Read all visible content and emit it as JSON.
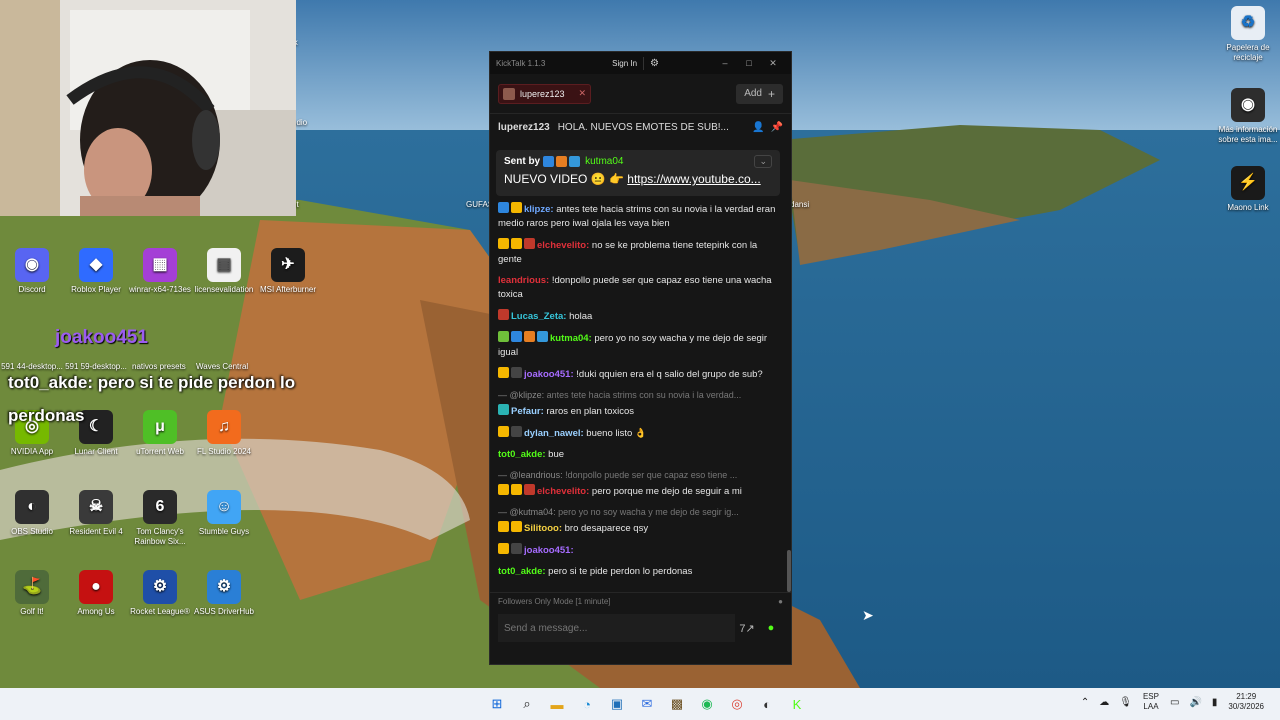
{
  "desktop": {
    "icons_left": [
      {
        "label": "Discord",
        "color": "#5865f2",
        "glyph": "◉"
      },
      {
        "label": "Roblox Player",
        "color": "#2f6bff",
        "glyph": "◆"
      },
      {
        "label": "winrar-x64-713es",
        "color": "#a43fd6",
        "glyph": "▦"
      },
      {
        "label": "licensevalidation",
        "color": "#f1f1f1",
        "glyph": "▤"
      },
      {
        "label": "MSI Afterburner",
        "color": "#1c1c1c",
        "glyph": "✈"
      },
      {
        "label": "NVIDIA App",
        "color": "#76b900",
        "glyph": "◎"
      },
      {
        "label": "Lunar Client",
        "color": "#222222",
        "glyph": "☾"
      },
      {
        "label": "uTorrent Web",
        "color": "#4fbf26",
        "glyph": "μ"
      },
      {
        "label": "FL Studio 2024",
        "color": "#f26b1d",
        "glyph": "♫"
      },
      {
        "label": "OBS Studio",
        "color": "#303030",
        "glyph": "◐"
      },
      {
        "label": "Resident Evil 4",
        "color": "#3a3a3a",
        "glyph": "☠"
      },
      {
        "label": "Tom Clancy's Rainbow Six...",
        "color": "#2a2a2a",
        "glyph": "6"
      },
      {
        "label": "Stumble Guys",
        "color": "#41a5f5",
        "glyph": "☺"
      },
      {
        "label": "Golf It!",
        "color": "#4f6b3a",
        "glyph": "⛳"
      },
      {
        "label": "Among Us",
        "color": "#c51111",
        "glyph": "●"
      },
      {
        "label": "Rocket League®",
        "color": "#1f4fa8",
        "glyph": "⚙"
      },
      {
        "label": "ASUS DriverHub",
        "color": "#2a7fd6",
        "glyph": "⚙"
      }
    ],
    "partial_labels": [
      "lk",
      "udio",
      "ut",
      "GUFAS",
      "dansi",
      "Waves Central",
      "nativos presets"
    ],
    "partial_desktop_labels": [
      "591 44-desktop...",
      "591 59-desktop..."
    ],
    "icons_right": [
      {
        "label": "Papelera de reciclaje",
        "color": "#e8eef5",
        "glyph": "♻"
      },
      {
        "label": "Más información sobre esta ima...",
        "color": "#2d2d2d",
        "glyph": "◉"
      },
      {
        "label": "Maono Link",
        "color": "#1a1a1a",
        "glyph": "⚡"
      }
    ]
  },
  "overlay": {
    "name": "joakoo451",
    "user": "tot0_akde",
    "message": ": pero si te pide perdon lo perdonas"
  },
  "window": {
    "title": "KickTalk 1.1.3",
    "sign_in": "Sign In",
    "tab_channel": "luperez123",
    "add_label": "Add",
    "pinned_header_user": "luperez123",
    "pinned_header_msg": "HOLA. NUEVOS EMOTES DE SUB!...",
    "pinned": {
      "sent_by": "Sent by",
      "user": "kutma04",
      "text": "NUEVO VIDEO",
      "link": "https://www.youtube.co..."
    },
    "messages": [
      {
        "type": "msg",
        "user": "klipze:",
        "color": "#6fa8ff",
        "badges": [
          "#2e86de",
          "#f5b700"
        ],
        "text": " antes tete hacia strims con su novia i la verdad eran medio raros pero iwal ojala les vaya bien"
      },
      {
        "type": "msg",
        "user": "elchevelito:",
        "color": "#e0303a",
        "badges": [
          "#f5b700",
          "#f5b700",
          "#c0392b"
        ],
        "text": " no se ke problema tiene tetepink con la gente"
      },
      {
        "type": "msg",
        "user": "leandrious:",
        "color": "#e0303a",
        "badges": [],
        "text": " !donpollo puede ser que capaz eso tiene una wacha toxica"
      },
      {
        "type": "msg",
        "user": "Lucas_Zeta:",
        "color": "#36c5d9",
        "badges": [
          "#c0392b"
        ],
        "text": " holaa"
      },
      {
        "type": "msg",
        "user": "kutma04:",
        "color": "#53fc18",
        "badges": [
          "#6fbf3a",
          "#2e86de",
          "#e67e22",
          "#3498db"
        ],
        "text": " pero yo no soy wacha y me dejo de segir igual"
      },
      {
        "type": "msg",
        "user": "joakoo451:",
        "color": "#a66cff",
        "badges": [
          "#f5b700",
          "#444444"
        ],
        "text": " !duki qquien era el q salio del grupo de sub?"
      },
      {
        "type": "reply",
        "user": "@klipze:",
        "text": " antes tete hacia strims con su novia i la verdad..."
      },
      {
        "type": "msg",
        "user": "Pefaur:",
        "color": "#9ad0ff",
        "badges": [
          "#2bb3b3"
        ],
        "text": " raros en plan toxicos"
      },
      {
        "type": "msg",
        "user": "dylan_nawel:",
        "color": "#9ad0ff",
        "badges": [
          "#f5b700",
          "#444444"
        ],
        "text": " bueno listo 👌"
      },
      {
        "type": "msg",
        "user": "tot0_akde:",
        "color": "#53fc18",
        "badges": [],
        "text": " bue"
      },
      {
        "type": "reply",
        "user": "@leandrious:",
        "text": " !donpollo puede ser que capaz eso tiene ..."
      },
      {
        "type": "msg",
        "user": "elchevelito:",
        "color": "#e0303a",
        "badges": [
          "#f5b700",
          "#f5b700",
          "#c0392b"
        ],
        "text": " pero porque me dejo de seguir a mi"
      },
      {
        "type": "reply",
        "user": "@kutma04:",
        "text": " pero yo no soy wacha y me dejo de segir ig..."
      },
      {
        "type": "msg",
        "user": "Silitooo:",
        "color": "#f5d142",
        "badges": [
          "#f5b700",
          "#f5b700"
        ],
        "text": " bro desaparece qsy"
      },
      {
        "type": "msg",
        "user": "joakoo451:",
        "color": "#a66cff",
        "badges": [
          "#f5b700",
          "#444444"
        ],
        "text": ""
      },
      {
        "type": "msg",
        "user": "tot0_akde:",
        "color": "#53fc18",
        "badges": [],
        "text": " pero si te pide perdon lo perdonas"
      }
    ],
    "mode_label": "Followers Only Mode [1 minute]",
    "input_placeholder": "Send a message..."
  },
  "taskbar": {
    "lang_top": "ESP",
    "lang_bottom": "LAA",
    "time": "21:29",
    "date": "30/3/2026"
  }
}
